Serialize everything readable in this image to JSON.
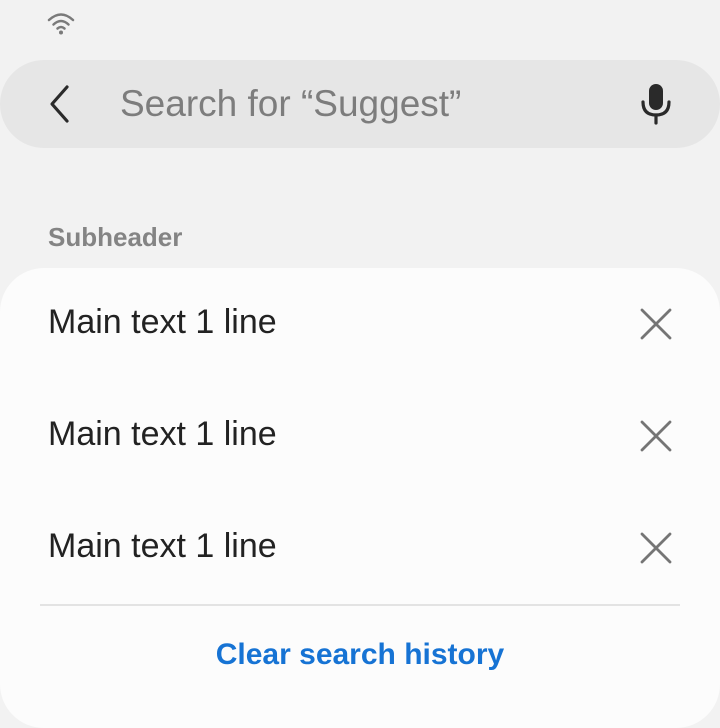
{
  "status_bar": {
    "wifi_icon": "wifi-icon"
  },
  "search_bar": {
    "back_icon": "chevron-left-icon",
    "placeholder": "Search for “Suggest”",
    "value": "",
    "mic_icon": "microphone-icon"
  },
  "subheader": "Subheader",
  "history": {
    "items": [
      {
        "label": "Main text 1 line",
        "action_icon": "close-icon"
      },
      {
        "label": "Main text 1 line",
        "action_icon": "close-icon"
      },
      {
        "label": "Main text 1 line",
        "action_icon": "close-icon"
      }
    ],
    "clear_label": "Clear search history"
  },
  "colors": {
    "background": "#f2f2f2",
    "search_bar": "#e6e6e6",
    "card": "#fcfcfc",
    "accent": "#1673d4",
    "subheader": "#848484",
    "icon": "#757575"
  }
}
